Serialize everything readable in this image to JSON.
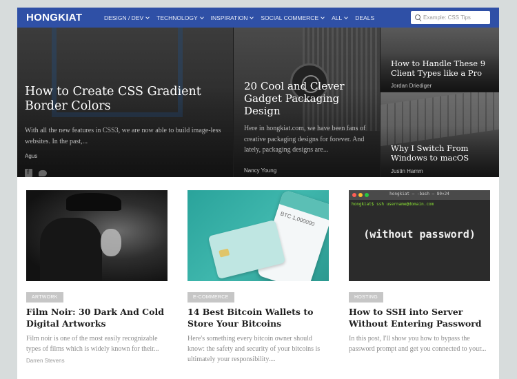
{
  "header": {
    "logo": "HONGKIAT",
    "nav": [
      {
        "label": "DESIGN / DEV",
        "dropdown": true
      },
      {
        "label": "TECHNOLOGY",
        "dropdown": true
      },
      {
        "label": "INSPIRATION",
        "dropdown": true
      },
      {
        "label": "SOCIAL COMMERCE",
        "dropdown": true
      },
      {
        "label": "ALL",
        "dropdown": true
      },
      {
        "label": "DEALS",
        "dropdown": false
      }
    ],
    "search": {
      "placeholder": "Example: CSS Tips",
      "value": ""
    },
    "accent_color": "#2f50a6"
  },
  "hero": {
    "main": {
      "title": "How to Create CSS Gradient Border Colors",
      "excerpt": "With all the new features in CSS3, we are now able to build image-less websites. In the past,...",
      "author": "Agus"
    },
    "middle": {
      "title": "20 Cool and Clever Gadget Packaging Design",
      "excerpt": "Here in hongkiat.com, we have been fans of creative packaging designs for forever. And lately, packaging designs are...",
      "author": "Nancy Young"
    },
    "right_top": {
      "title": "How to Handle These 9 Client Types like a Pro",
      "author": "Jordan Driediger"
    },
    "right_bottom": {
      "title": "Why I Switch From Windows to macOS",
      "author": "Justin Hamm"
    },
    "share_icons": [
      "facebook-icon",
      "twitter-icon"
    ]
  },
  "cards": [
    {
      "tag": "ARTWORK",
      "title": "Film Noir: 30 Dark And Cold Digital Artworks",
      "excerpt": "Film noir is one of the most easily recognizable types of films which is widely known for their...",
      "author": "Darren Stevens"
    },
    {
      "tag": "E-COMMERCE",
      "title": "14 Best Bitcoin Wallets to Store Your Bitcoins",
      "excerpt": "Here's something every bitcoin owner should know: the safety and security of your bitcoins is ultimately your responsibility....",
      "author": "",
      "image_text": "BTC 1,000000"
    },
    {
      "tag": "HOSTING",
      "title": "How to SSH into Server Without Entering Password",
      "excerpt": "In this post, I'll show you how to bypass the password prompt and get you connected to your...",
      "author": "",
      "image_text": {
        "window_title": "hongkiat — -bash — 80×24",
        "prompt": "hongkiat$ ssh username@domain.com",
        "caption": "(without password)"
      }
    }
  ]
}
